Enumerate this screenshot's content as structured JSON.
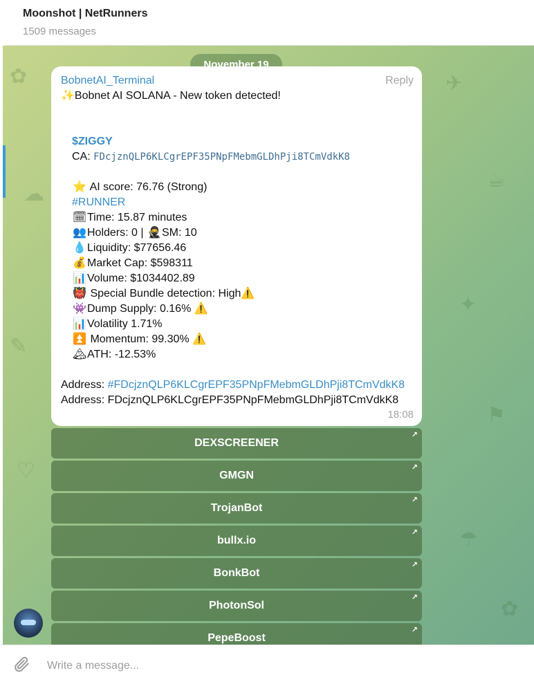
{
  "header": {
    "title": "Moonshot | NetRunners",
    "subtitle": "1509 messages"
  },
  "chat": {
    "date_label": "November 19",
    "message": {
      "sender": "BobnetAI_Terminal",
      "reply_label": "Reply",
      "headline_emoji": "✨",
      "headline": "Bobnet AI SOLANA - New token detected!",
      "ticker": "$ZIGGY",
      "ca_label": "CA:",
      "ca_value": "FDcjznQLP6KLCgrEPF35PNpFMebmGLDhPji8TCmVdkK8",
      "ai_score_emoji": "⭐",
      "ai_score": "AI score: 76.76 (Strong)",
      "runner_tag": "#RUNNER",
      "time_emoji": "🗓",
      "time_text": "Time: 15.87 minutes",
      "holders_emoji": "👥",
      "holders_text": "Holders: 0 |",
      "sm_emoji": "🥷",
      "sm_text": "SM: 10",
      "liquidity_emoji": "💧",
      "liquidity_text": "Liquidity: $77656.46",
      "marketcap_emoji": "💰",
      "marketcap_text": "Market Cap: $598311",
      "volume_emoji": "📊",
      "volume_text": "Volume: $1034402.89",
      "bundle_emoji": "👹",
      "bundle_text": "Special Bundle detection: High",
      "warning_emoji": "⚠️",
      "dump_emoji": "👾",
      "dump_text": "Dump Supply: 0.16%",
      "volatility_emoji": "📊",
      "volatility_text": "Volatility 1.71%",
      "momentum_emoji": "⏫",
      "momentum_text": "Momentum: 99.30%",
      "ath_emoji": "🏔",
      "ath_text": "ATH: -12.53%",
      "address_label": "Address:",
      "address_hashtag": "#FDcjznQLP6KLCgrEPF35PNpFMebmGLDhPji8TCmVdkK8",
      "address_plain": "FDcjznQLP6KLCgrEPF35PNpFMebmGLDhPji8TCmVdkK8",
      "time": "18:08"
    },
    "buttons": [
      {
        "label": "DEXSCREENER"
      },
      {
        "label": "GMGN"
      },
      {
        "label": "TrojanBot"
      },
      {
        "label": "bullx.io"
      },
      {
        "label": "BonkBot"
      },
      {
        "label": "PhotonSol"
      },
      {
        "label": "PepeBoost"
      }
    ],
    "button_arrow": "↗"
  },
  "composer": {
    "placeholder": "Write a message..."
  },
  "colors": {
    "accent": "#3a8ec6",
    "button_bg": "#50734699",
    "bubble_bg": "#ffffff"
  },
  "icons": [
    "attach-icon",
    "external-link-icon",
    "avatar"
  ]
}
